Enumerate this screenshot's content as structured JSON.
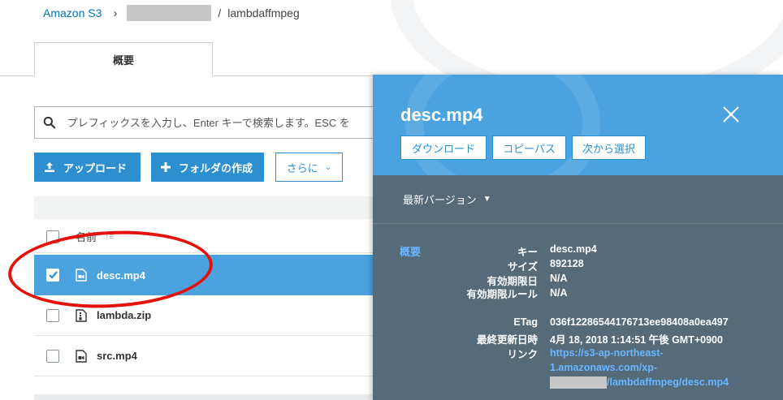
{
  "breadcrumb": {
    "root": "Amazon S3",
    "current": "lambdaffmpeg"
  },
  "tabs": [
    {
      "label": "概要"
    }
  ],
  "search": {
    "placeholder": "プレフィックスを入力し、Enter キーで検索します。ESC を"
  },
  "toolbar": {
    "upload_label": "アップロード",
    "create_folder_label": "フォルダの作成",
    "more_label": "さらに"
  },
  "table": {
    "column_name": "名前",
    "rows": [
      {
        "name": "desc.mp4",
        "selected": true,
        "icon": "video-file-icon"
      },
      {
        "name": "lambda.zip",
        "selected": false,
        "icon": "zip-file-icon"
      },
      {
        "name": "src.mp4",
        "selected": false,
        "icon": "video-file-icon"
      }
    ]
  },
  "panel": {
    "title": "desc.mp4",
    "buttons": {
      "download": "ダウンロード",
      "copy_path": "コピーパス",
      "select_from": "次から選択"
    },
    "version_label": "最新バージョン",
    "section_label": "概要",
    "properties": {
      "key_label": "キー",
      "key_value": "desc.mp4",
      "size_label": "サイズ",
      "size_value": "892128",
      "expiry_date_label": "有効期限日",
      "expiry_date_value": "N/A",
      "expiry_rule_label": "有効期限ルール",
      "expiry_rule_value": "N/A",
      "etag_label": "ETag",
      "etag_value": "036f12286544176713ee98408a0ea497",
      "modified_label": "最終更新日時",
      "modified_value": "4月 18, 2018 1:14:51 午後 GMT+0900",
      "link_label": "リンク",
      "link_line1": "https://s3-ap-northeast-",
      "link_line2": "1.amazonaws.com/xp-",
      "link_line3": "/lambdaffmpeg/desc.mp4"
    }
  },
  "colors": {
    "accent": "#2d8fd0",
    "selected_row": "#4aa3df",
    "panel_bg": "#556b79",
    "annotation": "#e3120b"
  }
}
